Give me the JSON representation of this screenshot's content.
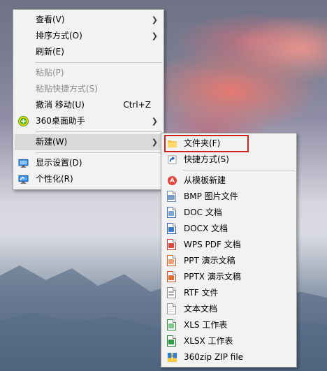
{
  "context_menu": {
    "items": [
      {
        "label": "查看(V)"
      },
      {
        "label": "排序方式(O)"
      },
      {
        "label": "刷新(E)"
      },
      {
        "label": "粘贴(P)"
      },
      {
        "label": "粘贴快捷方式(S)"
      },
      {
        "label": "撤消 移动(U)",
        "shortcut": "Ctrl+Z"
      },
      {
        "label": "360桌面助手"
      },
      {
        "label": "新建(W)"
      },
      {
        "label": "显示设置(D)"
      },
      {
        "label": "个性化(R)"
      }
    ]
  },
  "new_submenu": {
    "items": [
      {
        "label": "文件夹(F)"
      },
      {
        "label": "快捷方式(S)"
      },
      {
        "label": "从模板新建"
      },
      {
        "label": "BMP 图片文件"
      },
      {
        "label": "DOC 文档"
      },
      {
        "label": "DOCX 文档"
      },
      {
        "label": "WPS PDF 文档"
      },
      {
        "label": "PPT 演示文稿"
      },
      {
        "label": "PPTX 演示文稿"
      },
      {
        "label": "RTF 文件"
      },
      {
        "label": "文本文档"
      },
      {
        "label": "XLS 工作表"
      },
      {
        "label": "XLSX 工作表"
      },
      {
        "label": "360zip ZIP file"
      }
    ]
  },
  "colors": {
    "menu_bg": "#f2f2f2",
    "hover_bg": "#d9d9d9",
    "highlight_border": "#d12020",
    "disabled_text": "#8b8b8b"
  }
}
